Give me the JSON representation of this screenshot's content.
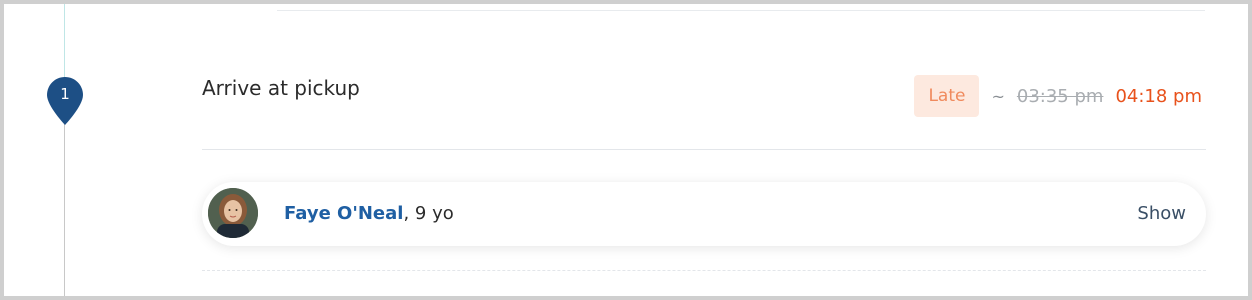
{
  "stop": {
    "number": "1",
    "title": "Arrive at pickup",
    "status_badge": "Late",
    "tilde": "~",
    "scheduled_time": "03:35 pm",
    "estimated_time": "04:18 pm"
  },
  "passenger": {
    "name": "Faye O'Neal",
    "age_suffix": ", 9 yo",
    "show_label": "Show"
  },
  "colors": {
    "pin": "#1d4f85",
    "late_badge_bg": "#fde9df",
    "late_badge_text": "#f08a5d",
    "estimated_time": "#e8521c",
    "passenger_name": "#1f5fa3"
  },
  "icons": {
    "pin": "map-pin-icon",
    "avatar": "passenger-avatar"
  }
}
